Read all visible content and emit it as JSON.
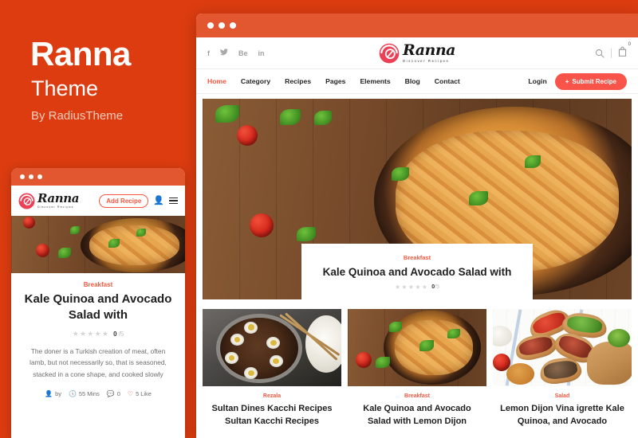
{
  "promo": {
    "title": "Ranna",
    "subtitle": "Theme",
    "byline": "By RadiusTheme"
  },
  "colors": {
    "brand_bg": "#dc3c10",
    "titlebar": "#e2572f",
    "accent": "#f4573f",
    "button": "#f9544a"
  },
  "mobile": {
    "titlebar_dots": 3,
    "logo": {
      "name": "Ranna",
      "tagline": "Discover Recipes"
    },
    "add_recipe_label": "Add Recipe",
    "user_icon": "user-icon",
    "menu_icon": "hamburger-menu-icon",
    "card": {
      "category": "Breakfast",
      "title": "Kale Quinoa and Avocado Salad with",
      "rating_stars": "★★★★★",
      "rating_score": "0",
      "rating_out_of": "/5",
      "description": "The doner is a Turkish creation of meat, often lamb, but not necessarily so, that is seasoned, stacked in a cone shape, and cooked slowly",
      "meta": {
        "author_label": "by",
        "time": "55 Mins",
        "comments": "0",
        "likes": "5 Like"
      }
    }
  },
  "browser": {
    "titlebar_dots": 3,
    "socials": [
      {
        "name": "facebook-icon",
        "glyph": "f"
      },
      {
        "name": "twitter-icon",
        "glyph": "🐦"
      },
      {
        "name": "behance-icon",
        "glyph": "Be"
      },
      {
        "name": "linkedin-icon",
        "glyph": "in"
      }
    ],
    "logo": {
      "name": "Ranna",
      "tagline": "Discover Recipes"
    },
    "top_right": {
      "search_icon": "search-icon",
      "cart_icon": "cart-icon",
      "cart_count": "0"
    },
    "nav": {
      "links": [
        {
          "label": "Home",
          "active": true
        },
        {
          "label": "Category",
          "active": false
        },
        {
          "label": "Recipes",
          "active": false
        },
        {
          "label": "Pages",
          "active": false
        },
        {
          "label": "Elements",
          "active": false
        },
        {
          "label": "Blog",
          "active": false
        },
        {
          "label": "Contact",
          "active": false
        }
      ],
      "login_label": "Login",
      "submit_label": "Submit Recipe",
      "submit_icon": "plus-icon"
    },
    "hero": {
      "image_alt": "penne-pasta-in-dark-bowl-on-wooden-table",
      "category": "Breakfast",
      "title": "Kale Quinoa and Avocado Salad with",
      "rating_stars": "★★★★★",
      "rating_score": "0",
      "rating_out_of": "/5"
    },
    "recipe_cards": [
      {
        "image_alt": "braised-pork-with-eggs-in-pan-with-rice",
        "category": "Rezala",
        "title_line1": "Sultan Dines Kacchi Recipes",
        "title_line2": "Sultan Kacchi Recipes"
      },
      {
        "image_alt": "penne-pasta-in-dark-bowl",
        "category": "Breakfast",
        "title_line1": "Kale Quinoa and Avocado",
        "title_line2": "Salad with Lemon Dijon"
      },
      {
        "image_alt": "assorted-bruschetta-on-white-wood-board",
        "category": "Salad",
        "title_line1": "Lemon Dijon Vina igrette Kale",
        "title_line2": "Quinoa, and Avocado"
      }
    ]
  }
}
